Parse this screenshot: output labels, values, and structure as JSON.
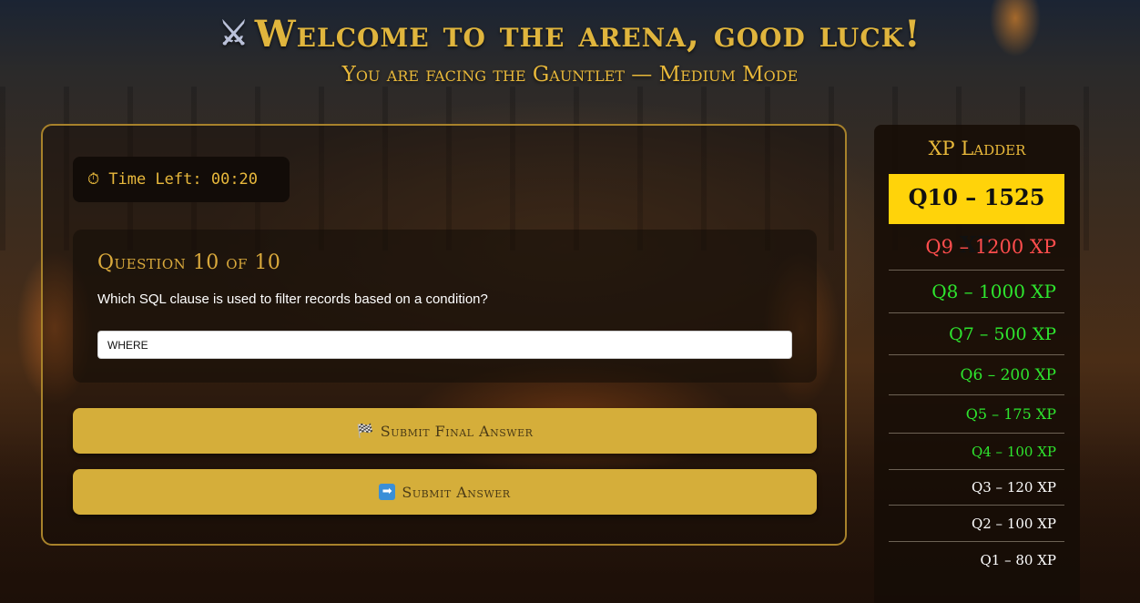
{
  "header": {
    "title": "Welcome to the arena, good luck!",
    "title_icon": "crossed-swords-icon",
    "subtitle": "You are facing the Gauntlet — Medium Mode"
  },
  "timer": {
    "icon": "stopwatch-icon",
    "label": "Time Left: 00:20"
  },
  "question": {
    "heading": "Question 10 of 10",
    "text": "Which SQL clause is used to filter records based on a condition?",
    "answer_value": "WHERE",
    "answer_placeholder": ""
  },
  "buttons": {
    "final_icon": "checkered-flag-icon",
    "final_label": "Submit Final Answer",
    "submit_icon": "right-arrow-icon",
    "submit_label": "Submit Answer"
  },
  "ladder": {
    "title": "XP Ladder",
    "items": [
      {
        "label": "Q10 – 1525 XP",
        "color": "#111111",
        "current": true
      },
      {
        "label": "Q9 – 1200 XP",
        "color": "#ff4d4d",
        "current": false
      },
      {
        "label": "Q8 – 1000 XP",
        "color": "#2ee52e",
        "current": false
      },
      {
        "label": "Q7 – 500 XP",
        "color": "#2ee52e",
        "current": false
      },
      {
        "label": "Q6 – 200 XP",
        "color": "#2ee52e",
        "current": false
      },
      {
        "label": "Q5 – 175 XP",
        "color": "#2ee52e",
        "current": false
      },
      {
        "label": "Q4 – 100 XP",
        "color": "#2ee52e",
        "current": false
      },
      {
        "label": "Q3 – 120 XP",
        "color": "#ffffff",
        "current": false
      },
      {
        "label": "Q2 – 100 XP",
        "color": "#ffffff",
        "current": false
      },
      {
        "label": "Q1 – 80 XP",
        "color": "#ffffff",
        "current": false
      }
    ],
    "highlight_color": "#ffd30a"
  },
  "colors": {
    "gold": "#e0b53d",
    "button": "#d5ae3a"
  }
}
